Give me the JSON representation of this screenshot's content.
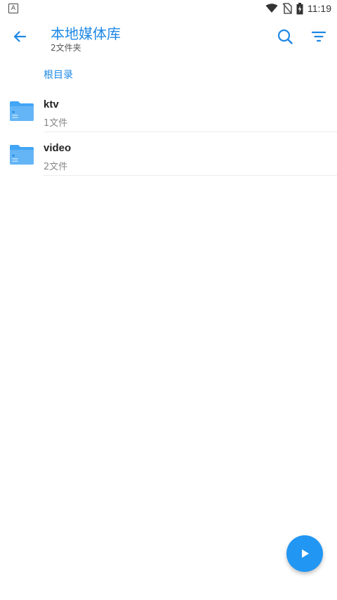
{
  "status_bar": {
    "left_badge": "A",
    "time": "11:19",
    "icons": [
      "wifi-icon",
      "no-sim-icon",
      "battery-charging-icon"
    ]
  },
  "app_bar": {
    "title": "本地媒体库",
    "subtitle": "2文件夹",
    "back_icon": "arrow-left-icon",
    "search_icon": "search-icon",
    "filter_icon": "filter-icon"
  },
  "breadcrumb": {
    "root_label": "根目录"
  },
  "folders": [
    {
      "name": "ktv",
      "count": "1文件",
      "icon": "folder-icon"
    },
    {
      "name": "video",
      "count": "2文件",
      "icon": "folder-icon"
    }
  ],
  "fab": {
    "icon": "play-icon"
  },
  "colors": {
    "accent": "#1e88e5",
    "fab": "#2196f3",
    "folder": "#42a5f5"
  }
}
